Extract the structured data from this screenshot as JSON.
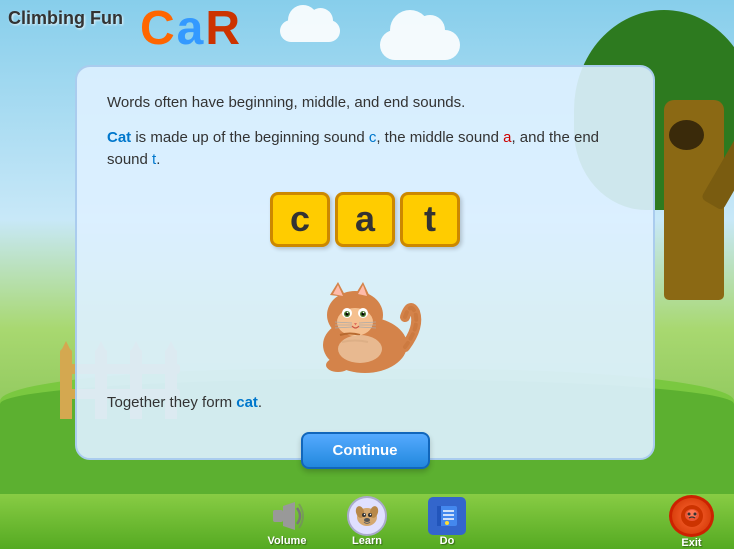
{
  "app": {
    "title": "Climbing Fun"
  },
  "letters_decoration": {
    "c": "C",
    "a": "a",
    "r": "R"
  },
  "content": {
    "intro_text": "Words often have beginning, middle, and end sounds.",
    "explanation_part1": " is made up of the beginning sound ",
    "explanation_part2": ", the middle sound ",
    "explanation_part3": ", and the end sound ",
    "highlight_word": "Cat",
    "highlight_c": "c",
    "highlight_a": "a",
    "highlight_t": "t",
    "blocks": [
      "c",
      "a",
      "t"
    ],
    "together_prefix": "Together they form ",
    "together_word": "cat",
    "together_suffix": "."
  },
  "buttons": {
    "continue_label": "Continue"
  },
  "toolbar": {
    "volume_label": "Volume",
    "learn_label": "Learn",
    "do_label": "Do",
    "exit_label": "Exit"
  }
}
